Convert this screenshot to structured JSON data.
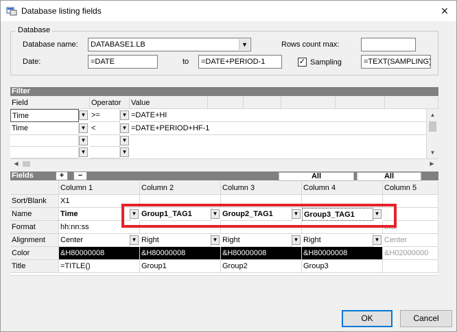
{
  "window": {
    "title": "Database listing fields",
    "close_icon": "×"
  },
  "database": {
    "group_label": "Database",
    "name_label": "Database name:",
    "name_value": "DATABASE1.LB",
    "rows_label": "Rows count max:",
    "rows_value": "",
    "date_label": "Date:",
    "date_from": "=DATE",
    "to_label": "to",
    "date_to": "=DATE+PERIOD-1",
    "sampling_label": "Sampling",
    "sampling_checked": "✓",
    "sampling_value": "=TEXT(SAMPLING)"
  },
  "filter": {
    "header": "Filter",
    "columns": [
      "Field",
      "Operator",
      "Value"
    ],
    "rows": [
      {
        "field": "Time",
        "operator": ">=",
        "value": "=DATE+HI"
      },
      {
        "field": "Time",
        "operator": "<",
        "value": "=DATE+PERIOD+HF-1"
      },
      {
        "field": "",
        "operator": "",
        "value": ""
      },
      {
        "field": "",
        "operator": "",
        "value": ""
      }
    ]
  },
  "fields": {
    "header": "Fields",
    "add": "+",
    "remove": "−",
    "all_1": "All",
    "all_2": "All",
    "row_labels": [
      "Sort/Blank",
      "Name",
      "Format",
      "Alignment",
      "Color",
      "Title"
    ],
    "columns": [
      {
        "header": "Column 1",
        "sort": "X1",
        "name": "Time",
        "format": "hh:nn:ss",
        "align": "Center",
        "color": "&H80000008",
        "title": "=TITLE()"
      },
      {
        "header": "Column 2",
        "sort": "",
        "name": "Group1_TAG1",
        "format": "",
        "align": "Right",
        "color": "&H80000008",
        "title": "Group1"
      },
      {
        "header": "Column 3",
        "sort": "",
        "name": "Group2_TAG1",
        "format": "",
        "align": "Right",
        "color": "&H80000008",
        "title": "Group2"
      },
      {
        "header": "Column 4",
        "sort": "",
        "name": "Group3_TAG1",
        "format": "",
        "align": "Right",
        "color": "&H80000008",
        "title": "Group3"
      },
      {
        "header": "Column 5",
        "sort": "",
        "name": "",
        "format": "eral",
        "align": "Center",
        "color": "&H02000000",
        "title": ""
      }
    ]
  },
  "buttons": {
    "ok": "OK",
    "cancel": "Cancel"
  },
  "icons": {
    "dropdown": "▼",
    "scroll_up": "▲",
    "scroll_down": "▼",
    "scroll_left": "◀",
    "scroll_right": "▶"
  },
  "colors": {
    "highlight": "#e3232a",
    "panel_header": "#808080"
  }
}
